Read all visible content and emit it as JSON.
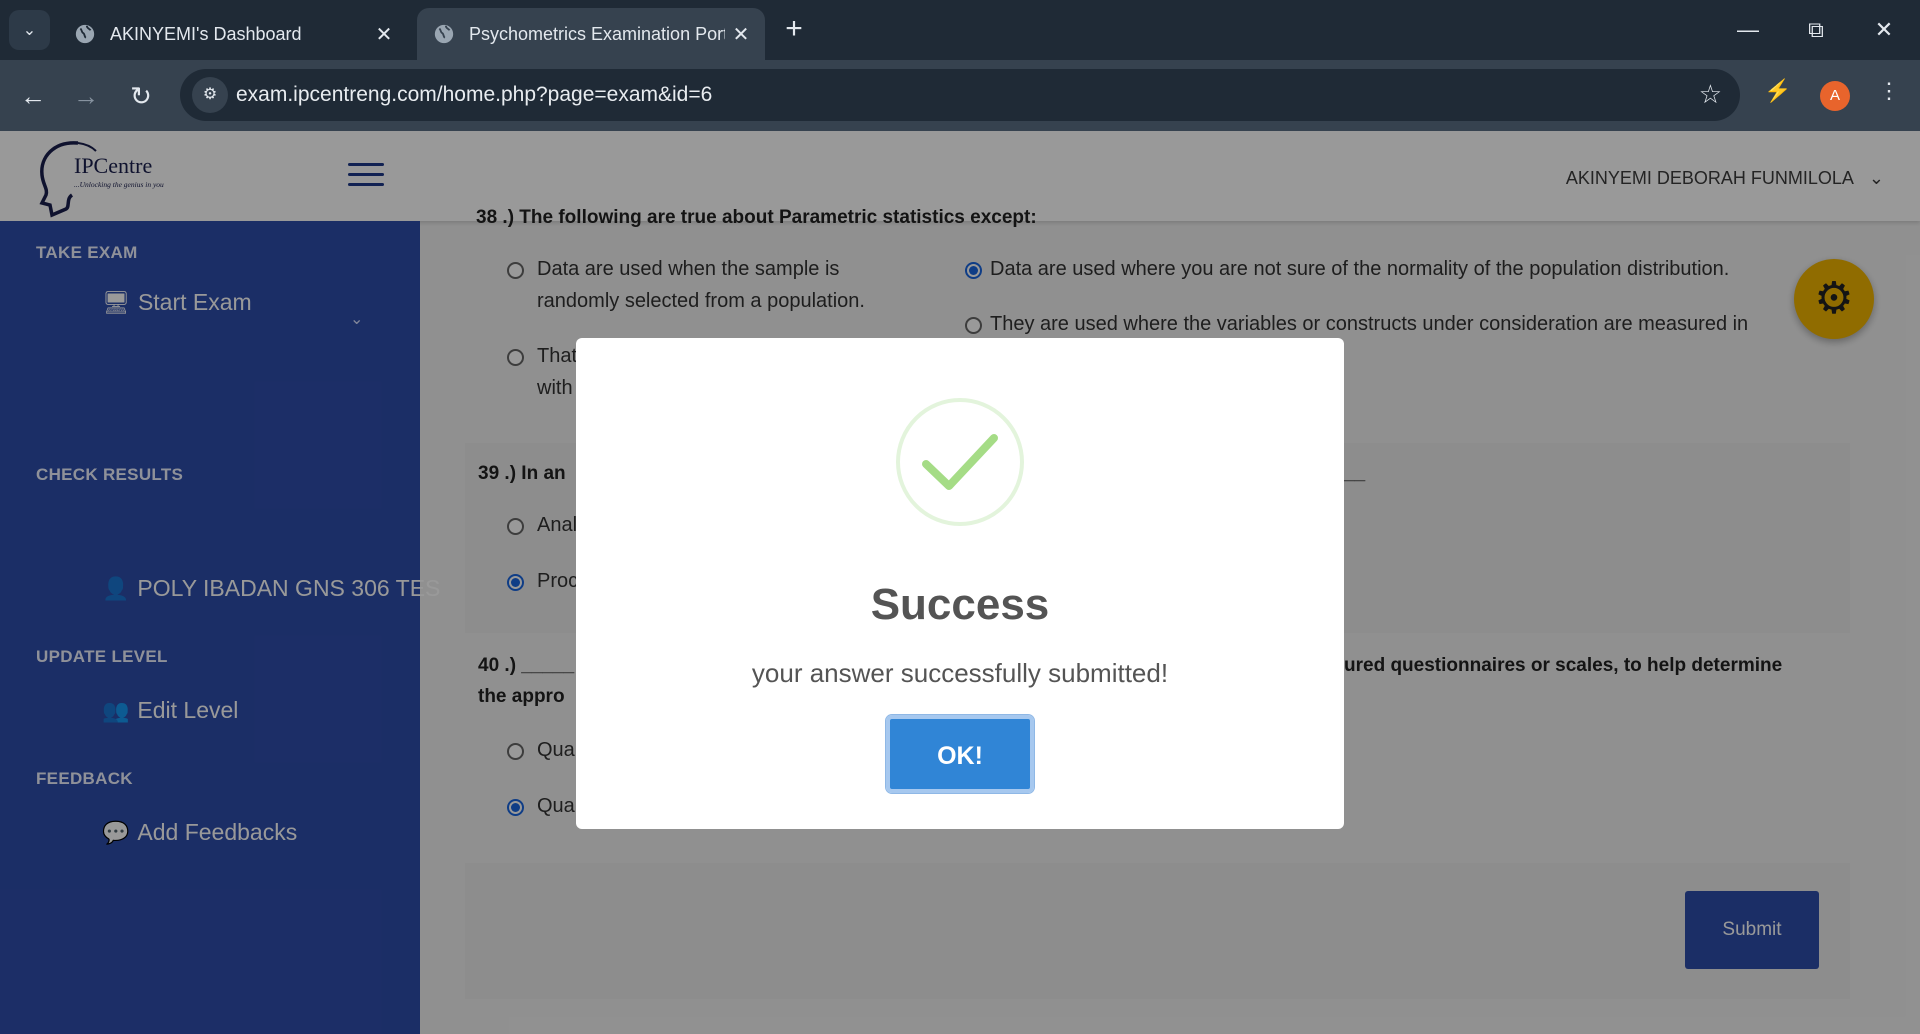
{
  "browser": {
    "tabs": [
      {
        "title": "AKINYEMI's Dashboard",
        "active": false
      },
      {
        "title": "Psychometrics Examination Port",
        "active": true
      }
    ],
    "new_tab": "+",
    "url_host": "exam.ipcentreng.com",
    "url_path": "/home.php?page=exam&id=6",
    "profile_initial": "A"
  },
  "app": {
    "logo_name": "IPCentre",
    "logo_tagline": "...Unlocking the genius in you",
    "user_name": "AKINYEMI DEBORAH FUNMILOLA"
  },
  "sidebar": {
    "sections": [
      {
        "heading": "TAKE EXAM",
        "item": "Start Exam",
        "icon": "chalkboard-teacher-icon"
      },
      {
        "heading": "CHECK RESULTS",
        "item": "POLY IBADAN GNS 306 TES",
        "icon": "user-check-icon"
      },
      {
        "heading": "UPDATE LEVEL",
        "item": "Edit Level",
        "icon": "users-cog-icon"
      },
      {
        "heading": "FEEDBACK",
        "item": "Add Feedbacks",
        "icon": "comment-dots-icon"
      }
    ]
  },
  "exam": {
    "q38": {
      "header": "38 .)   The following are true about Parametric statistics except:",
      "options": [
        "Data are used when the sample is randomly selected from a population.",
        "Data are used where you are not sure of the normality of the population distribution.",
        "That",
        "They are used where the variables or constructs under consideration are measured in"
      ],
      "option3_line2": "with"
    },
    "q39": {
      "header_start": "39 .) In an",
      "header_end": "__",
      "options": [
        "Anal",
        "Proc"
      ]
    },
    "q40": {
      "header_start": "40 .) _____",
      "header_end": "ured questionnaires or scales, to help determine",
      "header_line2": "the appro",
      "options": [
        "Qua",
        "Qua"
      ]
    },
    "submit_label": "Submit"
  },
  "modal": {
    "title": "Success",
    "message": "your answer successfully submitted!",
    "ok_label": "OK!"
  }
}
